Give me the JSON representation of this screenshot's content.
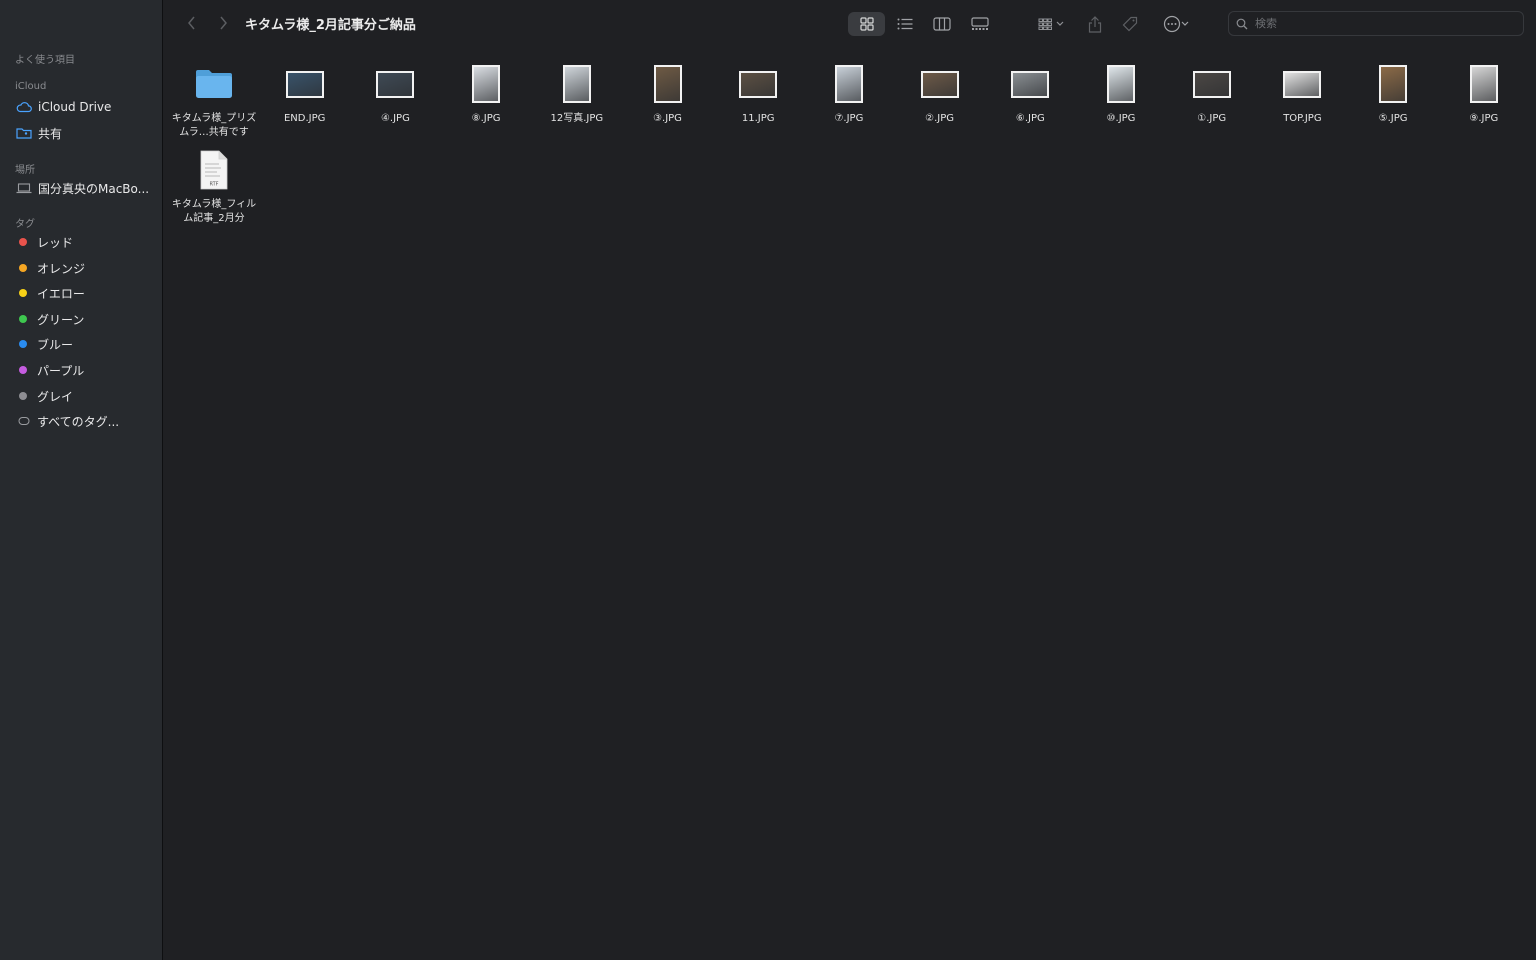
{
  "window": {
    "title": "キタムラ様_2月記事分ご納品"
  },
  "sidebar": {
    "favorites_header": "よく使う項目",
    "icloud_header": "iCloud",
    "icloud_items": [
      {
        "label": "iCloud Drive",
        "icon": "cloud-icon"
      },
      {
        "label": "共有",
        "icon": "shared-folder-icon"
      }
    ],
    "locations_header": "場所",
    "locations": [
      {
        "label": "国分真央のMacBo...",
        "icon": "laptop-icon"
      }
    ],
    "tags_header": "タグ",
    "tags": [
      {
        "label": "レッド",
        "color": "#e9534c"
      },
      {
        "label": "オレンジ",
        "color": "#f5a623"
      },
      {
        "label": "イエロー",
        "color": "#f7d117"
      },
      {
        "label": "グリーン",
        "color": "#3ec74f"
      },
      {
        "label": "ブルー",
        "color": "#2a8cf0"
      },
      {
        "label": "パープル",
        "color": "#c55ce0"
      },
      {
        "label": "グレイ",
        "color": "#8e8e93"
      }
    ],
    "all_tags_label": "すべてのタグ..."
  },
  "toolbar": {
    "view_icons": [
      "icon-view-icon",
      "list-view-icon",
      "column-view-icon",
      "gallery-view-icon"
    ],
    "group_icon": "group-icon",
    "share_icon": "share-icon",
    "tag_icon": "tag-icon",
    "more_icon": "more-icon"
  },
  "search": {
    "placeholder": "検索"
  },
  "files": [
    {
      "name": "キタムラ様_プリズムラ…共有です",
      "kind": "folder"
    },
    {
      "name": "END.JPG",
      "kind": "landscape",
      "tone": "#39536a"
    },
    {
      "name": "④.JPG",
      "kind": "landscape",
      "tone": "#3f4a55"
    },
    {
      "name": "⑧.JPG",
      "kind": "portrait",
      "tone": "#d9dde2"
    },
    {
      "name": "12写真.JPG",
      "kind": "portrait",
      "tone": "#cfd5da"
    },
    {
      "name": "③.JPG",
      "kind": "portrait",
      "tone": "#6e5a44"
    },
    {
      "name": "11.JPG",
      "kind": "landscape",
      "tone": "#5c5043"
    },
    {
      "name": "⑦.JPG",
      "kind": "portrait",
      "tone": "#c8d0d8"
    },
    {
      "name": "②.JPG",
      "kind": "landscape",
      "tone": "#6d5a48"
    },
    {
      "name": "⑥.JPG",
      "kind": "landscape",
      "tone": "#8a8f93"
    },
    {
      "name": "⑩.JPG",
      "kind": "portrait",
      "tone": "#dfe6ea"
    },
    {
      "name": "①.JPG",
      "kind": "landscape",
      "tone": "#4b4744"
    },
    {
      "name": "TOP.JPG",
      "kind": "landscape",
      "tone": "#e2e2e2"
    },
    {
      "name": "⑤.JPG",
      "kind": "portrait",
      "tone": "#8b6a47"
    },
    {
      "name": "⑨.JPG",
      "kind": "portrait",
      "tone": "#d6d6d6"
    },
    {
      "name": "キタムラ様_フィルム記事_2月分",
      "kind": "rtf",
      "badge": "RTF"
    }
  ]
}
